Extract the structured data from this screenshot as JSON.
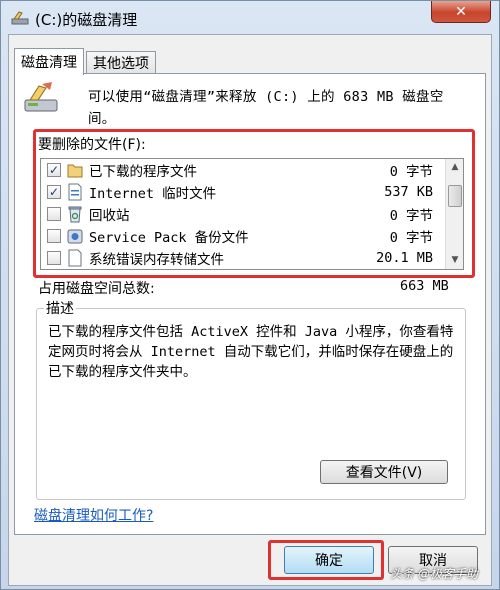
{
  "window": {
    "title": "(C:)的磁盘清理",
    "close_label": "✕"
  },
  "tabs": [
    {
      "label": "磁盘清理"
    },
    {
      "label": "其他选项"
    }
  ],
  "intro": "可以使用“磁盘清理”来释放 (C:) 上的 683 MB 磁盘空间。",
  "files_label": "要删除的文件(F):",
  "files": [
    {
      "name": "已下载的程序文件",
      "size": "0 字节",
      "checked": true,
      "icon": "folder-icon"
    },
    {
      "name": "Internet 临时文件",
      "size": "537 KB",
      "checked": true,
      "icon": "document-icon"
    },
    {
      "name": "回收站",
      "size": "0 字节",
      "checked": false,
      "icon": "recycle-bin-icon"
    },
    {
      "name": "Service Pack 备份文件",
      "size": "0 字节",
      "checked": false,
      "icon": "service-pack-icon"
    },
    {
      "name": "系统错误内存转储文件",
      "size": "20.1 MB",
      "checked": false,
      "icon": "file-icon"
    }
  ],
  "total": {
    "label": "占用磁盘空间总数:",
    "value": "663 MB"
  },
  "description": {
    "legend": "描述",
    "text": "已下载的程序文件包括 ActiveX 控件和 Java 小程序，你查看特定网页时将会从 Internet 自动下载它们，并临时保存在硬盘上的已下载的程序文件夹中。"
  },
  "view_files_label": "查看文件(V)",
  "help_link": "磁盘清理如何工作?",
  "ok_label": "确定",
  "cancel_label": "取消",
  "watermark": "头条 @极客手助",
  "colors": {
    "highlight": "#e03030",
    "link": "#1a5bbf"
  }
}
